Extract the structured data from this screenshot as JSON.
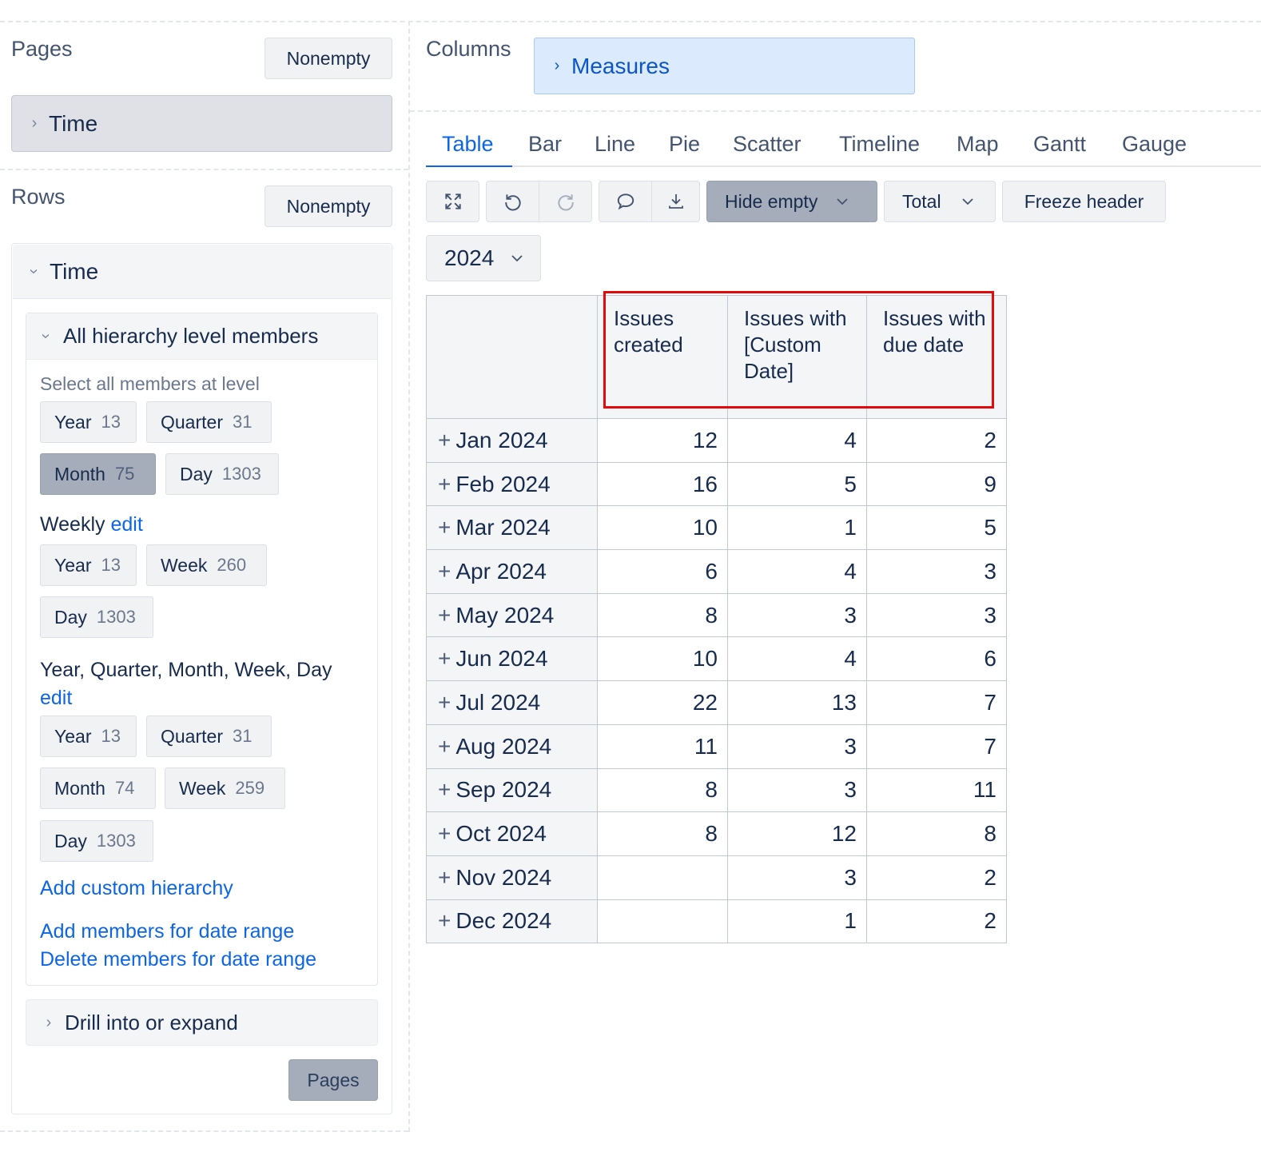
{
  "left": {
    "pages": {
      "title": "Pages",
      "nonempty": "Nonempty",
      "dimension": "Time"
    },
    "rows": {
      "title": "Rows",
      "nonempty": "Nonempty",
      "dimension": "Time",
      "all_members": {
        "title": "All hierarchy level members",
        "hint": "Select all members at level",
        "default_chips": [
          {
            "label": "Year",
            "count": "13"
          },
          {
            "label": "Quarter",
            "count": "31"
          },
          {
            "label": "Month",
            "count": "75",
            "selected": true
          },
          {
            "label": "Day",
            "count": "1303"
          }
        ],
        "weekly": {
          "title": "Weekly",
          "edit": "edit",
          "chips": [
            {
              "label": "Year",
              "count": "13"
            },
            {
              "label": "Week",
              "count": "260"
            },
            {
              "label": "Day",
              "count": "1303"
            }
          ]
        },
        "custom": {
          "title": "Year, Quarter, Month, Week, Day",
          "edit": "edit",
          "chips": [
            {
              "label": "Year",
              "count": "13"
            },
            {
              "label": "Quarter",
              "count": "31"
            },
            {
              "label": "Month",
              "count": "74"
            },
            {
              "label": "Week",
              "count": "259"
            },
            {
              "label": "Day",
              "count": "1303"
            }
          ]
        },
        "add_custom": "Add custom hierarchy",
        "add_range": "Add members for date range",
        "delete_range": "Delete members for date range"
      },
      "drill": "Drill into or expand",
      "pages_button": "Pages"
    }
  },
  "right": {
    "columns": {
      "title": "Columns",
      "dimension": "Measures"
    },
    "tabs": [
      "Table",
      "Bar",
      "Line",
      "Pie",
      "Scatter",
      "Timeline",
      "Map",
      "Gantt",
      "Gauge"
    ],
    "active_tab": "Table",
    "toolbar": {
      "icons": [
        "fullscreen-icon",
        "undo-icon",
        "redo-icon",
        "comment-icon",
        "download-icon"
      ],
      "hide_empty": "Hide empty",
      "total": "Total",
      "freeze": "Freeze header"
    },
    "page_select": "2024",
    "table": {
      "headers": [
        "Issues created",
        "Issues with [Custom Date]",
        "Issues with due date"
      ],
      "rows": [
        {
          "label": "Jan 2024",
          "values": [
            "12",
            "4",
            "2"
          ]
        },
        {
          "label": "Feb 2024",
          "values": [
            "16",
            "5",
            "9"
          ]
        },
        {
          "label": "Mar 2024",
          "values": [
            "10",
            "1",
            "5"
          ]
        },
        {
          "label": "Apr 2024",
          "values": [
            "6",
            "4",
            "3"
          ]
        },
        {
          "label": "May 2024",
          "values": [
            "8",
            "3",
            "3"
          ]
        },
        {
          "label": "Jun 2024",
          "values": [
            "10",
            "4",
            "6"
          ]
        },
        {
          "label": "Jul 2024",
          "values": [
            "22",
            "13",
            "7"
          ]
        },
        {
          "label": "Aug 2024",
          "values": [
            "11",
            "3",
            "7"
          ]
        },
        {
          "label": "Sep 2024",
          "values": [
            "8",
            "3",
            "11"
          ]
        },
        {
          "label": "Oct 2024",
          "values": [
            "8",
            "12",
            "8"
          ]
        },
        {
          "label": "Nov 2024",
          "values": [
            "",
            "3",
            "2"
          ]
        },
        {
          "label": "Dec 2024",
          "values": [
            "",
            "1",
            "2"
          ]
        }
      ]
    },
    "highlight_color": "#e20a0a",
    "accent_color": "#0c66e4"
  }
}
